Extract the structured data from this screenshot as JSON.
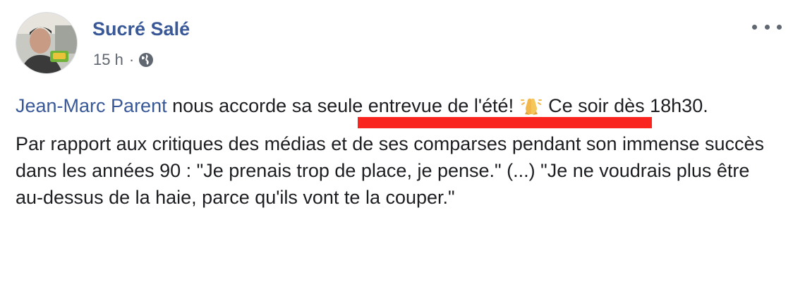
{
  "post": {
    "author": "Sucré Salé",
    "time": "15 h",
    "separator": "·",
    "icons": {
      "avatar": "profile-photo",
      "privacy": "globe-icon",
      "menu": "more-options-icon",
      "emoji": "praying-hands-icon"
    },
    "body": {
      "mention": "Jean-Marc Parent",
      "p1_after_mention": " nous accorde sa seule entrevue de l'été! ",
      "p1_after_emoji": " Ce soir dès 18h30.",
      "p2": "Par rapport aux critiques des médias et de ses comparses pendant son immense succès dans les années 90 : \"Je prenais trop de place, je pense.\" (...) \"Je ne voudrais plus être au-dessus de la haie, parce qu'ils vont te la couper.\""
    },
    "highlight_color": "#f8241d",
    "link_color": "#385898"
  }
}
